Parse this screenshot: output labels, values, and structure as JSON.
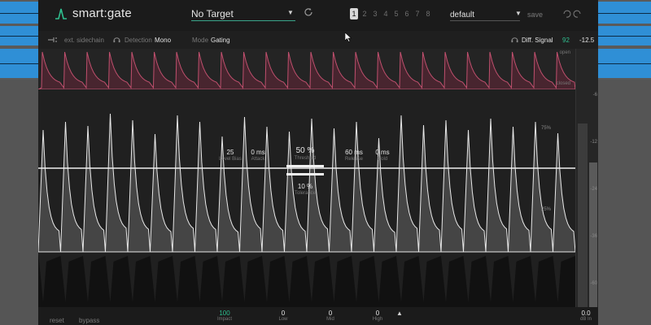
{
  "app": {
    "name": "smart:gate",
    "target": "No Target",
    "preset_slots": [
      "1",
      "2",
      "3",
      "4",
      "5",
      "6",
      "7",
      "8"
    ],
    "active_slot": "1",
    "preset": "default",
    "save_label": "save"
  },
  "controls": {
    "sidechain_label": "ext. sidechain",
    "detection_label": "Detection",
    "detection_value": "Mono",
    "mode_label": "Mode",
    "mode_value": "Gating",
    "diff_signal_label": "Diff. Signal",
    "diff_signal_value": "92",
    "output_value": "-12.5"
  },
  "gate_lane": {
    "open_label": "open",
    "closed_label": "closed"
  },
  "params": {
    "level_bias": {
      "value": "25",
      "label": "Level Bias"
    },
    "attack": {
      "value": "0 ms",
      "label": "Attack"
    },
    "threshold": {
      "value": "50 %",
      "label": "Threshold"
    },
    "release": {
      "value": "60 ms",
      "label": "Release"
    },
    "hold": {
      "value": "0 ms",
      "label": "Hold"
    },
    "tolerance": {
      "value": "10 %",
      "label": "Tolerance"
    }
  },
  "scale": {
    "pct_75": "75%",
    "pct_25": "25%",
    "db_ticks": [
      "-6",
      "-12",
      "-24",
      "-36",
      "-60"
    ]
  },
  "bottom": {
    "reset_label": "reset",
    "bypass_label": "bypass",
    "impact": {
      "value": "100",
      "label": "Impact"
    },
    "low": {
      "value": "0",
      "label": "Low"
    },
    "mid": {
      "value": "0",
      "label": "Mid"
    },
    "high": {
      "value": "0",
      "label": "High"
    },
    "db_in": {
      "value": "0.0",
      "label": "dB In"
    }
  },
  "colors": {
    "accent": "#2fbf8f",
    "gate_curve": "#c0506e",
    "daw_track": "#2f8fd6"
  }
}
